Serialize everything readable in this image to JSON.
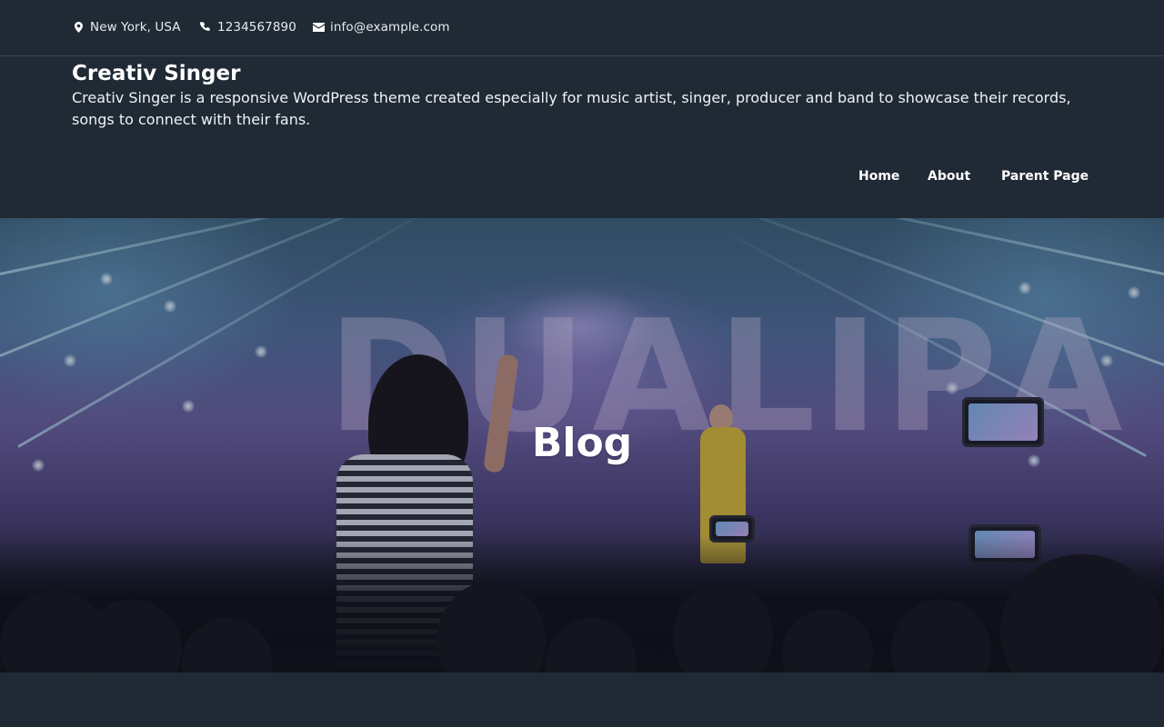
{
  "topbar": {
    "location": {
      "icon": "map-marker-icon",
      "text": "New York, USA"
    },
    "phone": {
      "icon": "phone-icon",
      "text": "1234567890"
    },
    "email": {
      "icon": "envelope-icon",
      "text": "info@example.com"
    }
  },
  "site": {
    "title": "Creativ Singer",
    "description": "Creativ Singer is a responsive WordPress theme created especially for music artist, singer, producer and band to showcase their records, songs to connect with their fans."
  },
  "nav": {
    "items": [
      {
        "label": "Home"
      },
      {
        "label": "About"
      },
      {
        "label": "Parent Page"
      }
    ]
  },
  "hero": {
    "title": "Blog",
    "image_subject": "concert crowd photo"
  },
  "colors": {
    "background": "#1f2a35",
    "text": "#ffffff"
  }
}
